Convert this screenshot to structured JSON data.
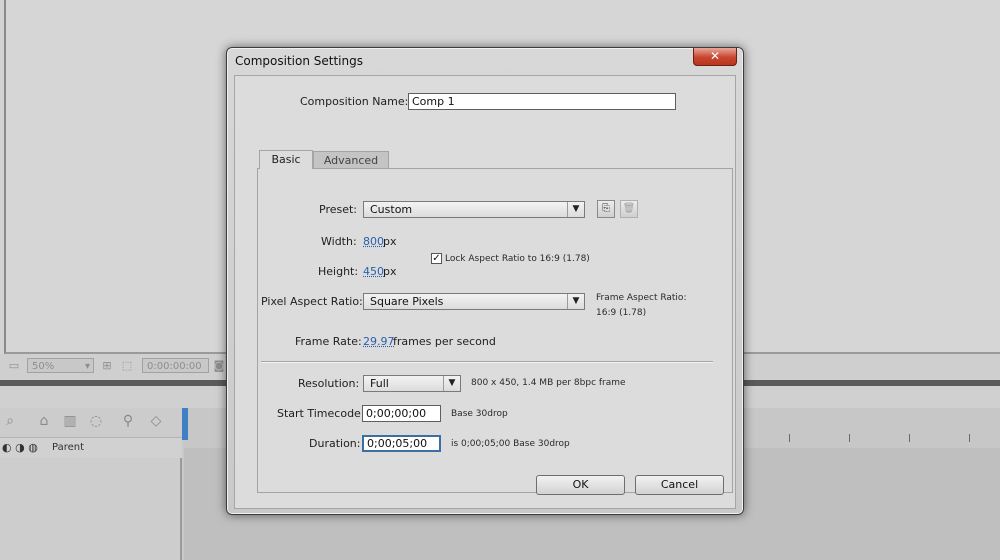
{
  "background": {
    "viewer_bar": {
      "zoom": "50%",
      "timecode": "0:00:00:00"
    },
    "timeline": {
      "parent_label": "Parent"
    }
  },
  "dialog": {
    "title": "Composition Settings",
    "close_symbol": "✕",
    "composition_name_label": "Composition Name:",
    "composition_name_value": "Comp 1",
    "tabs": [
      {
        "label": "Basic",
        "active": true
      },
      {
        "label": "Advanced",
        "active": false
      }
    ],
    "preset_label": "Preset:",
    "preset_value": "Custom",
    "width_label": "Width:",
    "width_value": "800",
    "width_unit": "px",
    "height_label": "Height:",
    "height_value": "450",
    "height_unit": "px",
    "lock_aspect_label": "Lock Aspect Ratio to 16:9 (1.78)",
    "lock_aspect_checked": true,
    "pixel_aspect_label": "Pixel Aspect Ratio:",
    "pixel_aspect_value": "Square Pixels",
    "frame_aspect_label": "Frame Aspect Ratio:",
    "frame_aspect_value": "16:9 (1.78)",
    "frame_rate_label": "Frame Rate:",
    "frame_rate_value": "29.97",
    "frame_rate_unit": "frames per second",
    "resolution_label": "Resolution:",
    "resolution_value": "Full",
    "resolution_info": "800 x 450, 1.4 MB per 8bpc frame",
    "start_timecode_label": "Start Timecode:",
    "start_timecode_value": "0;00;00;00",
    "start_timecode_base": "Base 30drop",
    "duration_label": "Duration:",
    "duration_value": "0;00;05;00",
    "duration_info": "is 0;00;05;00  Base 30drop",
    "ok_label": "OK",
    "cancel_label": "Cancel"
  },
  "colors": {
    "link": "#2a5fad",
    "close_button": "#c8452f",
    "playhead": "#3f7fc4"
  }
}
